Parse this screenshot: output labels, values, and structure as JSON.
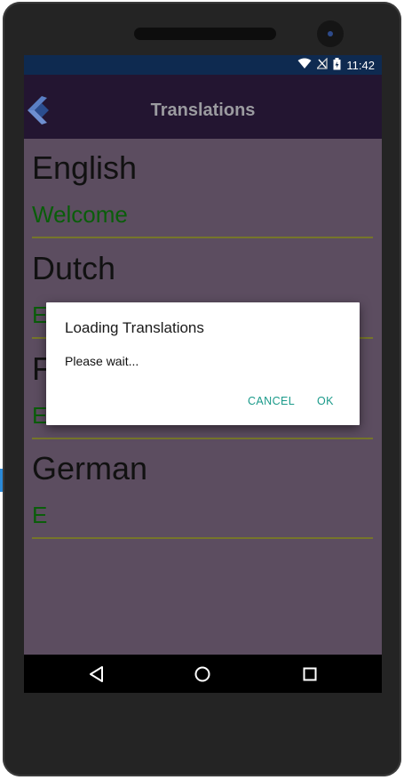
{
  "status_bar": {
    "time": "11:42"
  },
  "app_bar": {
    "title": "Translations"
  },
  "translations": [
    {
      "language": "English",
      "text": "Welcome"
    },
    {
      "language": "Dutch",
      "text": "E"
    },
    {
      "language": "F",
      "text": "E"
    },
    {
      "language": "German",
      "text": "E"
    }
  ],
  "dialog": {
    "title": "Loading Translations",
    "message": "Please wait...",
    "cancel_label": "CANCEL",
    "ok_label": "OK"
  },
  "colors": {
    "app_bar_bg": "#231531",
    "status_bar_bg": "#0e2a50",
    "content_bg": "#5c4d60",
    "translation_text": "#0a5d0a",
    "underline": "#76762a",
    "dialog_button": "#1a9a8a"
  },
  "icons": {
    "status": [
      "wifi-icon",
      "no-signal-icon",
      "battery-icon"
    ],
    "nav": [
      "back-icon",
      "home-icon",
      "recents-icon"
    ],
    "logo": "app-logo-icon"
  }
}
